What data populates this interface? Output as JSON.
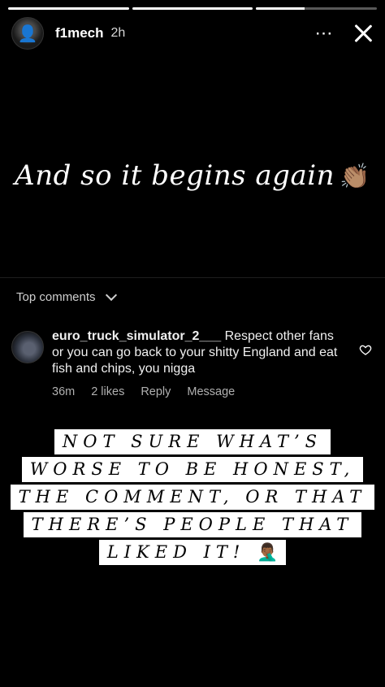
{
  "story": {
    "progress_segments": [
      1,
      1,
      0.4
    ],
    "username": "f1mech",
    "time": "2h",
    "more_icon": "⋯",
    "caption": "And so it begins again",
    "caption_emoji": "👏🏽"
  },
  "comments_section": {
    "title": "Top comments",
    "comment": {
      "username": "euro_truck_simulator_2___",
      "text": "Respect other fans or you can go back to your shitty England and eat fish and chips, you nigga",
      "age": "36m",
      "likes": "2 likes",
      "reply_label": "Reply",
      "message_label": "Message"
    }
  },
  "overlay_text": {
    "lines": [
      "NOT SURE WHAT’S",
      "WORSE TO BE HONEST,",
      "THE COMMENT, OR THAT",
      "THERE’S PEOPLE THAT",
      "LIKED IT!"
    ],
    "emoji": "🤦🏾‍♂️"
  }
}
